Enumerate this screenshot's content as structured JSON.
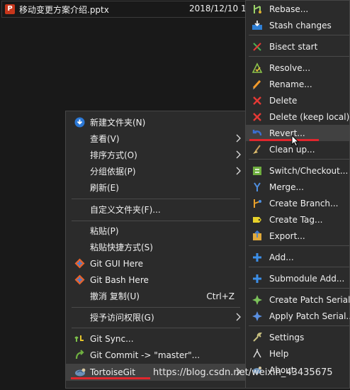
{
  "file": {
    "name": "移动变更方案介绍.pptx",
    "date": "2018/12/10 1"
  },
  "context_menu": {
    "items": [
      {
        "label": "新建文件夹(N)",
        "icon": "new-folder-icon"
      },
      {
        "label": "查看(V)",
        "submenu": true
      },
      {
        "label": "排序方式(O)",
        "submenu": true
      },
      {
        "label": "分组依据(P)",
        "submenu": true
      },
      {
        "label": "刷新(E)"
      },
      {
        "label": "自定义文件夹(F)..."
      },
      {
        "label": "粘贴(P)"
      },
      {
        "label": "粘贴快捷方式(S)"
      },
      {
        "label": "Git GUI Here",
        "icon": "git-gui-icon"
      },
      {
        "label": "Git Bash Here",
        "icon": "git-bash-icon"
      },
      {
        "label": "撤消 复制(U)",
        "shortcut": "Ctrl+Z"
      },
      {
        "label": "授予访问权限(G)",
        "submenu": true
      },
      {
        "label": "Git Sync...",
        "icon": "git-sync-icon"
      },
      {
        "label": "Git Commit -> \"master\"...",
        "icon": "git-commit-icon"
      },
      {
        "label": "TortoiseGit",
        "icon": "tortoisegit-icon",
        "submenu": true,
        "highlighted": true
      }
    ]
  },
  "tortoisegit_menu": {
    "items": [
      {
        "label": "Rebase...",
        "icon": "rebase-icon"
      },
      {
        "label": "Stash changes",
        "icon": "stash-icon"
      },
      {
        "label": "Bisect start",
        "icon": "bisect-icon"
      },
      {
        "label": "Resolve...",
        "icon": "resolve-icon"
      },
      {
        "label": "Rename...",
        "icon": "rename-icon"
      },
      {
        "label": "Delete",
        "icon": "delete-icon"
      },
      {
        "label": "Delete (keep local)",
        "icon": "delete-keep-local-icon"
      },
      {
        "label": "Revert...",
        "icon": "revert-icon",
        "highlighted": true
      },
      {
        "label": "Clean up...",
        "icon": "cleanup-icon"
      },
      {
        "label": "Switch/Checkout...",
        "icon": "switch-checkout-icon"
      },
      {
        "label": "Merge...",
        "icon": "merge-icon"
      },
      {
        "label": "Create Branch...",
        "icon": "create-branch-icon"
      },
      {
        "label": "Create Tag...",
        "icon": "create-tag-icon"
      },
      {
        "label": "Export...",
        "icon": "export-icon"
      },
      {
        "label": "Add...",
        "icon": "add-icon"
      },
      {
        "label": "Submodule Add...",
        "icon": "submodule-add-icon"
      },
      {
        "label": "Create Patch Serial...",
        "icon": "create-patch-icon"
      },
      {
        "label": "Apply Patch Serial...",
        "icon": "apply-patch-icon"
      },
      {
        "label": "Settings",
        "icon": "settings-icon"
      },
      {
        "label": "Help",
        "icon": "help-icon"
      },
      {
        "label": "About",
        "icon": "about-icon"
      }
    ]
  },
  "watermark": "https://blog.csdn.net/weixin_43435675",
  "colors": {
    "menu_bg": "#2b2b2b",
    "highlight": "#414141",
    "annotation_red": "#e0262d",
    "separator": "#4a4a4a"
  }
}
